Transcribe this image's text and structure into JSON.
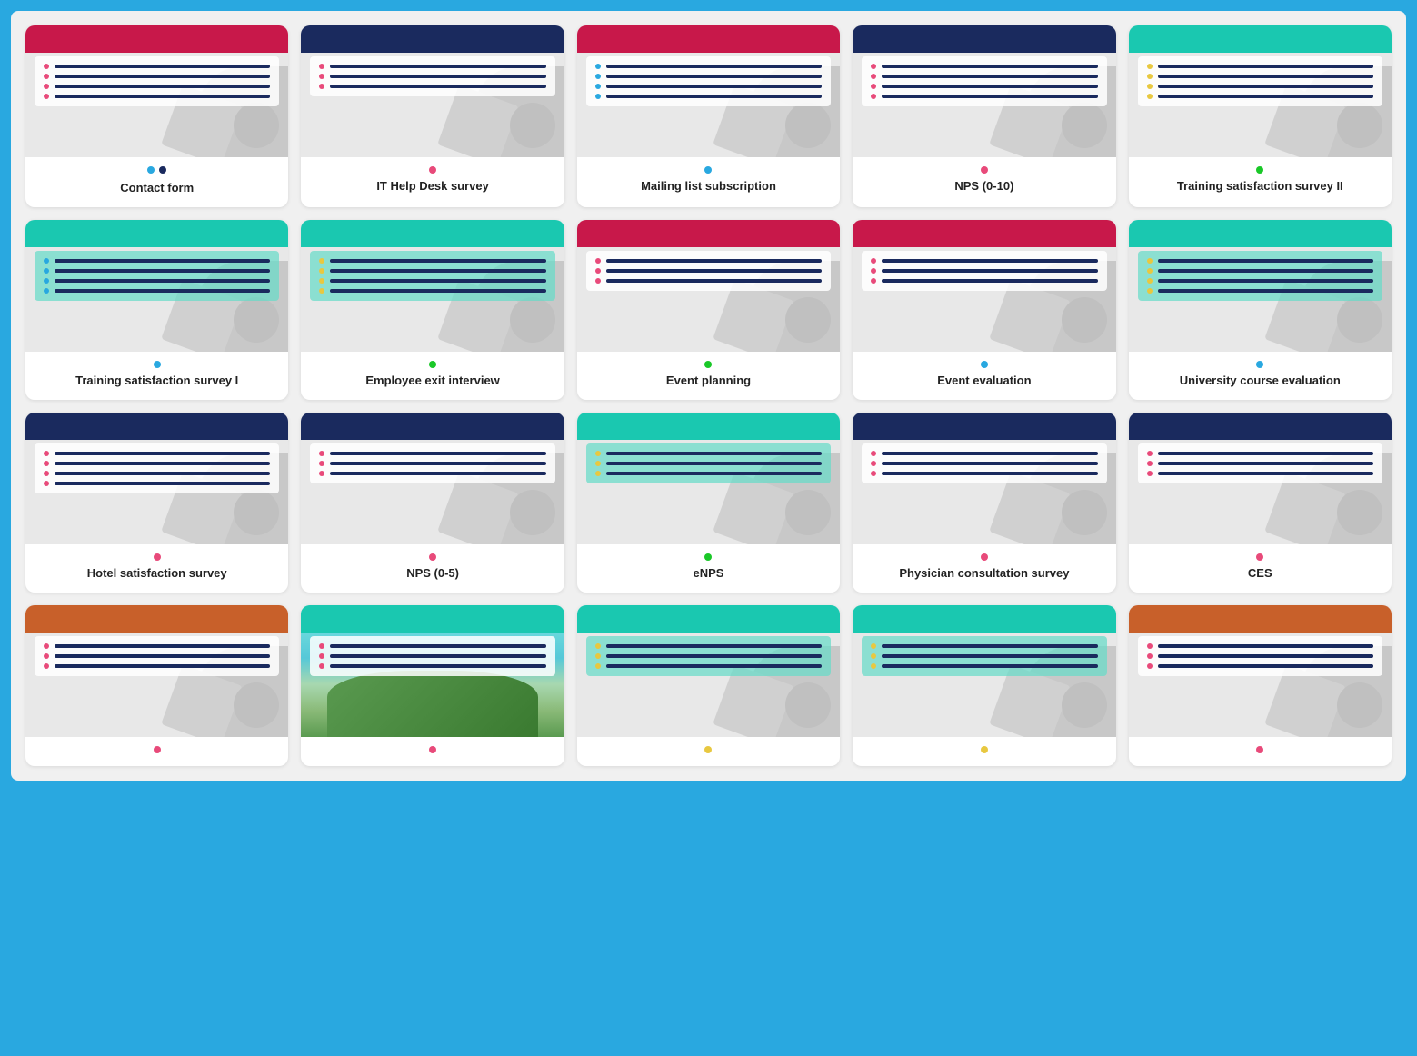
{
  "cards": [
    {
      "id": "contact-form",
      "title": "Contact form",
      "header_color": "#c8184a",
      "dot_color": "#1a9ad6",
      "dot2_color": "#1a2a5e",
      "has_two_dots": true,
      "dot_colors": [
        "#29a8e0",
        "#1a2a5e"
      ],
      "content_bg": "white",
      "dot_row_color": "#e84a7a",
      "line_colors": [
        "#1a2a5e",
        "#1a2a5e",
        "#1a2a5e",
        "#1a2a5e"
      ],
      "row_count": 4
    },
    {
      "id": "it-help-desk",
      "title": "IT Help Desk survey",
      "header_color": "#1a2a5e",
      "dot_color": "#e84a7a",
      "has_two_dots": false,
      "content_bg": "white",
      "dot_row_color": "#e84a7a",
      "line_colors": [
        "#1a2a5e",
        "#1a2a5e",
        "#1a2a5e"
      ],
      "row_count": 3
    },
    {
      "id": "mailing-list",
      "title": "Mailing list subscription",
      "header_color": "#c8184a",
      "dot_color": "#29a8e0",
      "has_two_dots": false,
      "content_bg": "white",
      "dot_row_color": "#29a8e0",
      "line_colors": [
        "#1a2a5e",
        "#1a2a5e",
        "#1a2a5e",
        "#1a2a5e"
      ],
      "row_count": 4
    },
    {
      "id": "nps-0-10",
      "title": "NPS (0-10)",
      "header_color": "#1a2a5e",
      "dot_color": "#e84a7a",
      "has_two_dots": false,
      "content_bg": "white",
      "dot_row_color": "#e84a7a",
      "line_colors": [
        "#1a2a5e",
        "#1a2a5e",
        "#1a2a5e",
        "#1a2a5e"
      ],
      "row_count": 4
    },
    {
      "id": "training-satisfaction-ii",
      "title": "Training satisfaction survey II",
      "header_color": "#1ac8b0",
      "dot_color": "#1ac828",
      "has_two_dots": false,
      "content_bg": "white",
      "dot_row_color": "#e8c840",
      "line_colors": [
        "#1a2a5e",
        "#1a2a5e",
        "#1a2a5e",
        "#1a2a5e"
      ],
      "row_count": 4
    },
    {
      "id": "training-satisfaction-i",
      "title": "Training satisfaction survey I",
      "header_color": "#1ac8b0",
      "dot_color": "#29a8e0",
      "has_two_dots": false,
      "content_bg": "#7de8d8",
      "dot_row_color": "#29a8e0",
      "line_colors": [
        "#1a2a5e",
        "#1a2a5e",
        "#1a2a5e",
        "#1a2a5e"
      ],
      "row_count": 4,
      "teal_bg": true
    },
    {
      "id": "employee-exit",
      "title": "Employee exit interview",
      "header_color": "#1ac8b0",
      "dot_color": "#1ac828",
      "has_two_dots": false,
      "content_bg": "#7de8d8",
      "dot_row_color": "#e8c840",
      "line_colors": [
        "#1a2a5e",
        "#1a2a5e",
        "#1a2a5e",
        "#1a2a5e"
      ],
      "row_count": 4,
      "teal_bg": true
    },
    {
      "id": "event-planning",
      "title": "Event planning",
      "header_color": "#c8184a",
      "dot_color": "#1ac828",
      "has_two_dots": false,
      "content_bg": "white",
      "dot_row_color": "#e84a7a",
      "line_colors": [
        "#1a2a5e",
        "#1a2a5e",
        "#1a2a5e"
      ],
      "row_count": 3
    },
    {
      "id": "event-evaluation",
      "title": "Event evaluation",
      "header_color": "#c8184a",
      "dot_color": "#29a8e0",
      "has_two_dots": false,
      "content_bg": "white",
      "dot_row_color": "#e84a7a",
      "line_colors": [
        "#1a2a5e",
        "#1a2a5e",
        "#1a2a5e"
      ],
      "row_count": 3
    },
    {
      "id": "university-course",
      "title": "University course evaluation",
      "header_color": "#1ac8b0",
      "dot_color": "#29a8e0",
      "has_two_dots": false,
      "content_bg": "#7de8d8",
      "dot_row_color": "#e8c840",
      "line_colors": [
        "#1a2a5e",
        "#1a2a5e",
        "#1a2a5e",
        "#1a2a5e"
      ],
      "row_count": 4,
      "teal_bg": true
    },
    {
      "id": "hotel-satisfaction",
      "title": "Hotel satisfaction survey",
      "header_color": "#1a2a5e",
      "dot_color": "#e84a7a",
      "has_two_dots": false,
      "content_bg": "white",
      "dot_row_color": "#e84a7a",
      "line_colors": [
        "#1a2a5e",
        "#1a2a5e",
        "#1a2a5e",
        "#1a2a5e"
      ],
      "row_count": 4
    },
    {
      "id": "nps-0-5",
      "title": "NPS (0-5)",
      "header_color": "#1a2a5e",
      "dot_color": "#e84a7a",
      "has_two_dots": false,
      "content_bg": "white",
      "dot_row_color": "#e84a7a",
      "line_colors": [
        "#1a2a5e",
        "#1a2a5e",
        "#1a2a5e"
      ],
      "row_count": 3
    },
    {
      "id": "enps",
      "title": "eNPS",
      "header_color": "#1ac8b0",
      "dot_color": "#1ac828",
      "has_two_dots": false,
      "content_bg": "#7de8d8",
      "dot_row_color": "#e8c840",
      "line_colors": [
        "#1a2a5e",
        "#1a2a5e",
        "#1a2a5e"
      ],
      "row_count": 3,
      "teal_bg": true
    },
    {
      "id": "physician-consultation",
      "title": "Physician consultation survey",
      "header_color": "#1a2a5e",
      "dot_color": "#e84a7a",
      "has_two_dots": false,
      "content_bg": "white",
      "dot_row_color": "#e84a7a",
      "line_colors": [
        "#1a2a5e",
        "#1a2a5e",
        "#1a2a5e"
      ],
      "row_count": 3
    },
    {
      "id": "ces",
      "title": "CES",
      "header_color": "#1a2a5e",
      "dot_color": "#e84a7a",
      "has_two_dots": false,
      "content_bg": "white",
      "dot_row_color": "#e84a7a",
      "line_colors": [
        "#1a2a5e",
        "#1a2a5e",
        "#1a2a5e"
      ],
      "row_count": 3
    },
    {
      "id": "row4-card1",
      "title": "",
      "header_color": "#c8602a",
      "dot_color": "#e84a7a",
      "has_two_dots": false,
      "content_bg": "white",
      "dot_row_color": "#e84a7a",
      "line_colors": [
        "#1a2a5e",
        "#1a2a5e",
        "#1a2a5e"
      ],
      "row_count": 3
    },
    {
      "id": "row4-card2",
      "title": "",
      "header_color": "#1ac8b0",
      "dot_color": "#e84a7a",
      "has_two_dots": false,
      "content_bg": "white",
      "dot_row_color": "#e84a7a",
      "line_colors": [
        "#1a2a5e",
        "#1a2a5e",
        "#1a2a5e"
      ],
      "row_count": 3,
      "has_image": true
    },
    {
      "id": "row4-card3",
      "title": "",
      "header_color": "#1ac8b0",
      "dot_color": "#e8c840",
      "has_two_dots": false,
      "content_bg": "#7de8d8",
      "dot_row_color": "#e8c840",
      "line_colors": [
        "#1a2a5e",
        "#1a2a5e",
        "#1a2a5e"
      ],
      "row_count": 3,
      "teal_bg": true
    },
    {
      "id": "row4-card4",
      "title": "",
      "header_color": "#1ac8b0",
      "dot_color": "#e8c840",
      "has_two_dots": false,
      "content_bg": "#7de8d8",
      "dot_row_color": "#e8c840",
      "line_colors": [
        "#1a2a5e",
        "#1a2a5e",
        "#1a2a5e"
      ],
      "row_count": 3,
      "teal_bg": true
    },
    {
      "id": "row4-card5",
      "title": "",
      "header_color": "#c8602a",
      "dot_color": "#e84a7a",
      "has_two_dots": false,
      "content_bg": "white",
      "dot_row_color": "#e84a7a",
      "line_colors": [
        "#1a2a5e",
        "#1a2a5e",
        "#1a2a5e"
      ],
      "row_count": 3
    }
  ]
}
